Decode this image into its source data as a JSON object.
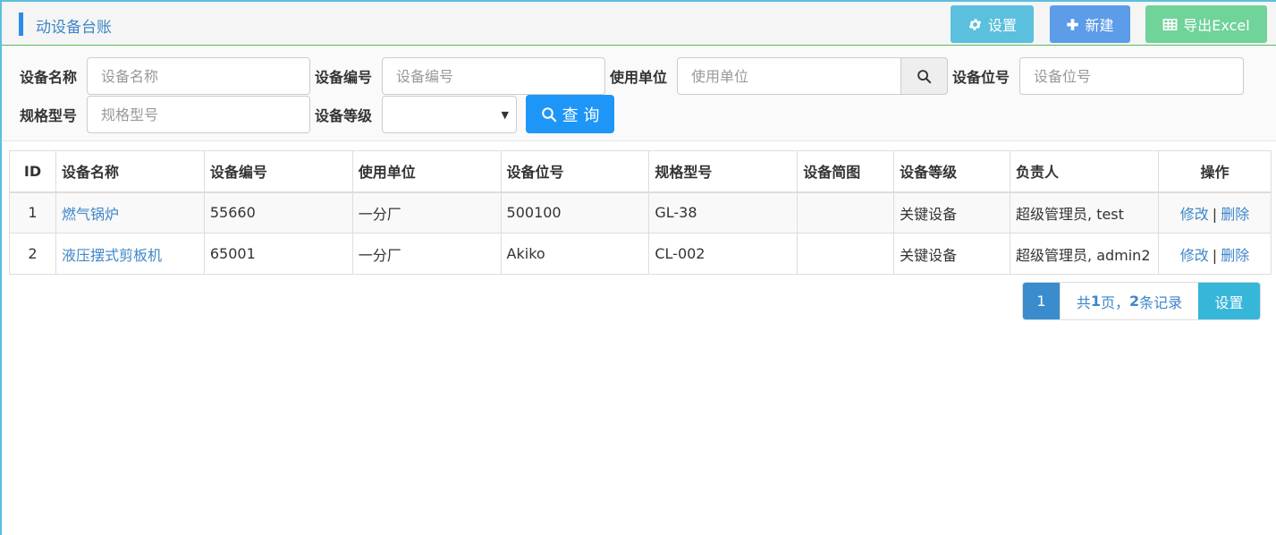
{
  "header": {
    "title": "动设备台账",
    "settings_label": "设置",
    "create_label": "新建",
    "export_label": "导出Excel"
  },
  "filters": {
    "name_label": "设备名称",
    "name_placeholder": "设备名称",
    "code_label": "设备编号",
    "code_placeholder": "设备编号",
    "unit_label": "使用单位",
    "unit_placeholder": "使用单位",
    "position_label": "设备位号",
    "position_placeholder": "设备位号",
    "model_label": "规格型号",
    "model_placeholder": "规格型号",
    "level_label": "设备等级",
    "level_value": "",
    "query_label": "查 询"
  },
  "table": {
    "columns": [
      "ID",
      "设备名称",
      "设备编号",
      "使用单位",
      "设备位号",
      "规格型号",
      "设备简图",
      "设备等级",
      "负责人",
      "操作"
    ],
    "rows": [
      {
        "id": "1",
        "name": "燃气锅炉",
        "code": "55660",
        "unit": "一分厂",
        "position": "500100",
        "model": "GL-38",
        "diagram": "",
        "level": "关键设备",
        "owner": "超级管理员, test",
        "edit": "修改",
        "sep": "|",
        "delete": "删除"
      },
      {
        "id": "2",
        "name": "液压摆式剪板机",
        "code": "65001",
        "unit": "一分厂",
        "position": "Akiko",
        "model": "CL-002",
        "diagram": "",
        "level": "关键设备",
        "owner": "超级管理员, admin2",
        "edit": "修改",
        "sep": "|",
        "delete": "删除"
      }
    ]
  },
  "pager": {
    "current_page": "1",
    "summary_prefix": "共",
    "total_pages": "1",
    "summary_mid": "页，",
    "total_records": "2",
    "summary_suffix": "条记录",
    "settings_label": "设置"
  },
  "colors": {
    "accent_blue": "#1e96f7",
    "header_info": "#5bc0de",
    "header_primary": "#5c9ce8",
    "header_success": "#6fd39a",
    "link": "#3f86c8"
  }
}
